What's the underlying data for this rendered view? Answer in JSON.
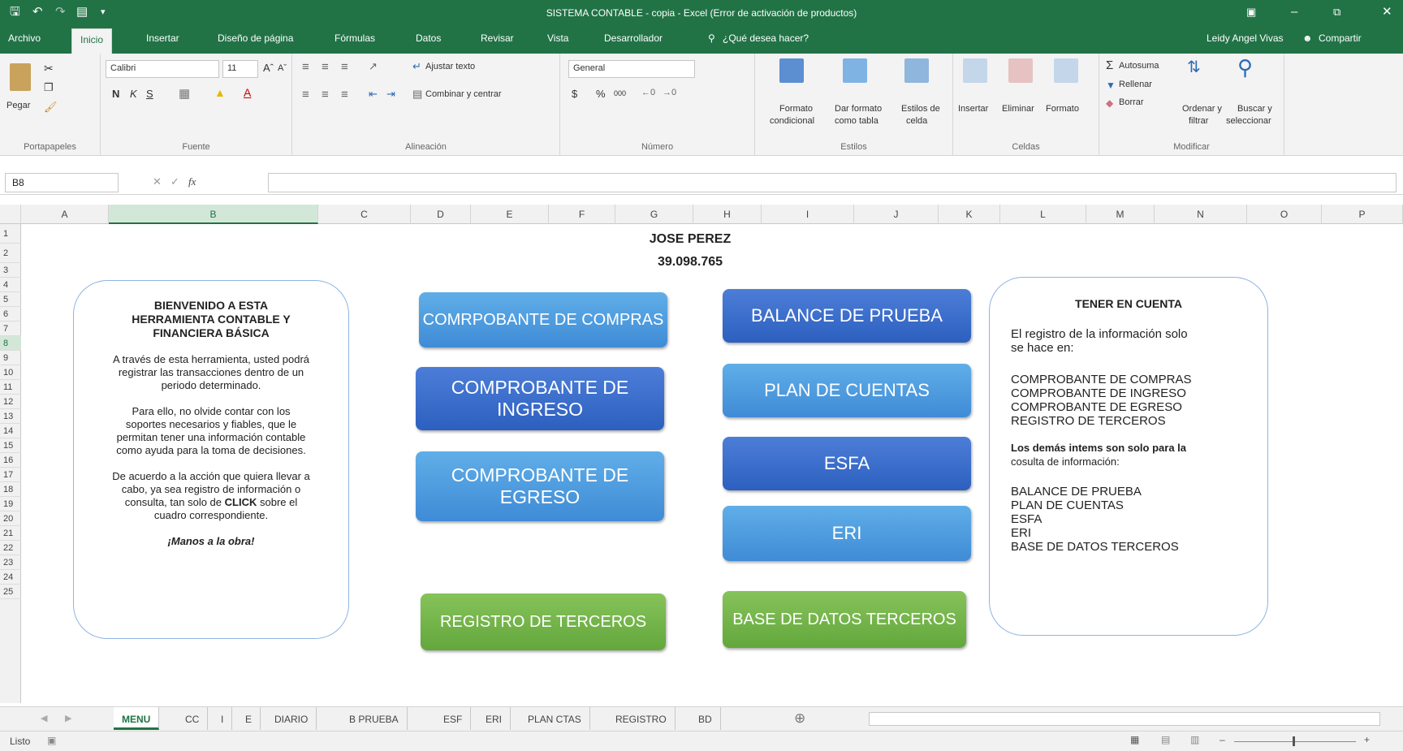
{
  "app": {
    "title": "SISTEMA CONTABLE - copia - Excel (Error de activación de productos)",
    "user": "Leidy Angel Vivas",
    "share": "Compartir"
  },
  "menu": {
    "tabs": [
      "Archivo",
      "Inicio",
      "Insertar",
      "Diseño de página",
      "Fórmulas",
      "Datos",
      "Revisar",
      "Vista",
      "Desarrollador"
    ],
    "tellme": "¿Qué desea hacer?"
  },
  "ribbon": {
    "clipboard": {
      "paste": "Pegar",
      "label": "Portapapeles"
    },
    "font": {
      "name": "Calibri",
      "size": "11",
      "bold": "N",
      "italic": "K",
      "underline": "S",
      "label": "Fuente"
    },
    "alignment": {
      "wrap": "Ajustar texto",
      "merge": "Combinar y centrar",
      "label": "Alineación"
    },
    "number": {
      "format": "General",
      "currency": "$",
      "percent": "%",
      "thousands": "000",
      "label": "Número"
    },
    "styles": {
      "cond1": "Formato",
      "cond2": "condicional",
      "table1": "Dar formato",
      "table2": "como tabla",
      "cell1": "Estilos de",
      "cell2": "celda",
      "label": "Estilos"
    },
    "cells": {
      "insert": "Insertar",
      "delete": "Eliminar",
      "format": "Formato",
      "label": "Celdas"
    },
    "editing": {
      "autosum": "Autosuma",
      "fill": "Rellenar",
      "clear": "Borrar",
      "sort1": "Ordenar y",
      "sort2": "filtrar",
      "find1": "Buscar y",
      "find2": "seleccionar",
      "label": "Modificar"
    }
  },
  "formula": {
    "namebox": "B8",
    "fx": "fx",
    "value": ""
  },
  "columns": [
    "A",
    "B",
    "C",
    "D",
    "E",
    "F",
    "G",
    "H",
    "I",
    "J",
    "K",
    "L",
    "M",
    "N",
    "O",
    "P"
  ],
  "rows": [
    "1",
    "2",
    "3",
    "4",
    "5",
    "6",
    "7",
    "8",
    "9",
    "10",
    "11",
    "12",
    "13",
    "14",
    "15",
    "16",
    "17",
    "18",
    "19",
    "20",
    "21",
    "22",
    "23",
    "24",
    "25"
  ],
  "sheet": {
    "name": "JOSE PEREZ",
    "id": "39.098.765",
    "welcome": {
      "title1": "BIENVENIDO A ESTA",
      "title2": "HERRAMIENTA CONTABLE Y",
      "title3": "FINANCIERA BÁSICA",
      "p1a": "A través de esta herramienta, usted podrá",
      "p1b": "registrar las transacciones dentro de un",
      "p1c": "periodo determinado.",
      "p2a": "Para ello, no olvide contar con los",
      "p2b": "soportes necesarios y fiables, que le",
      "p2c": "permitan tener una información contable",
      "p2d": "como ayuda para la toma de decisiones.",
      "p3a": "De acuerdo a la acción que quiera llevar a",
      "p3b": "cabo, ya sea registro de información o",
      "p3c": "consulta, tan solo de",
      "p3click": "CLICK",
      "p3d": "sobre el",
      "p3e": "cuadro correspondiente.",
      "closing": "¡Manos a la obra!"
    },
    "buttons": {
      "compras": "COMRPOBANTE DE COMPRAS",
      "ingreso": "COMPROBANTE DE INGRESO",
      "egreso": "COMPROBANTE DE EGRESO",
      "terceros": "REGISTRO DE TERCEROS",
      "balance": "BALANCE DE PRUEBA",
      "plan": "PLAN DE CUENTAS",
      "esfa": "ESFA",
      "eri": "ERI",
      "basedatos": "BASE DE DATOS TERCEROS"
    },
    "note": {
      "title": "TENER EN CUENTA",
      "intro1": "El registro de la información solo",
      "intro2": "se hace en:",
      "reg": [
        "COMPROBANTE DE COMPRAS",
        "COMPROBANTE DE INGRESO",
        "COMPROBANTE DE EGRESO",
        "REGISTRO DE TERCEROS"
      ],
      "other1": "Los demás intems son solo para la",
      "other2": "cosulta de información:",
      "cons": [
        "BALANCE DE PRUEBA",
        "PLAN DE CUENTAS",
        "ESFA",
        "ERI",
        "BASE DE DATOS TERCEROS"
      ]
    }
  },
  "sheettabs": [
    "MENU",
    "CC",
    "I",
    "E",
    "DIARIO",
    "B PRUEBA",
    "ESF",
    "ERI",
    "PLAN CTAS",
    "REGISTRO",
    "BD"
  ],
  "status": {
    "ready": "Listo"
  }
}
